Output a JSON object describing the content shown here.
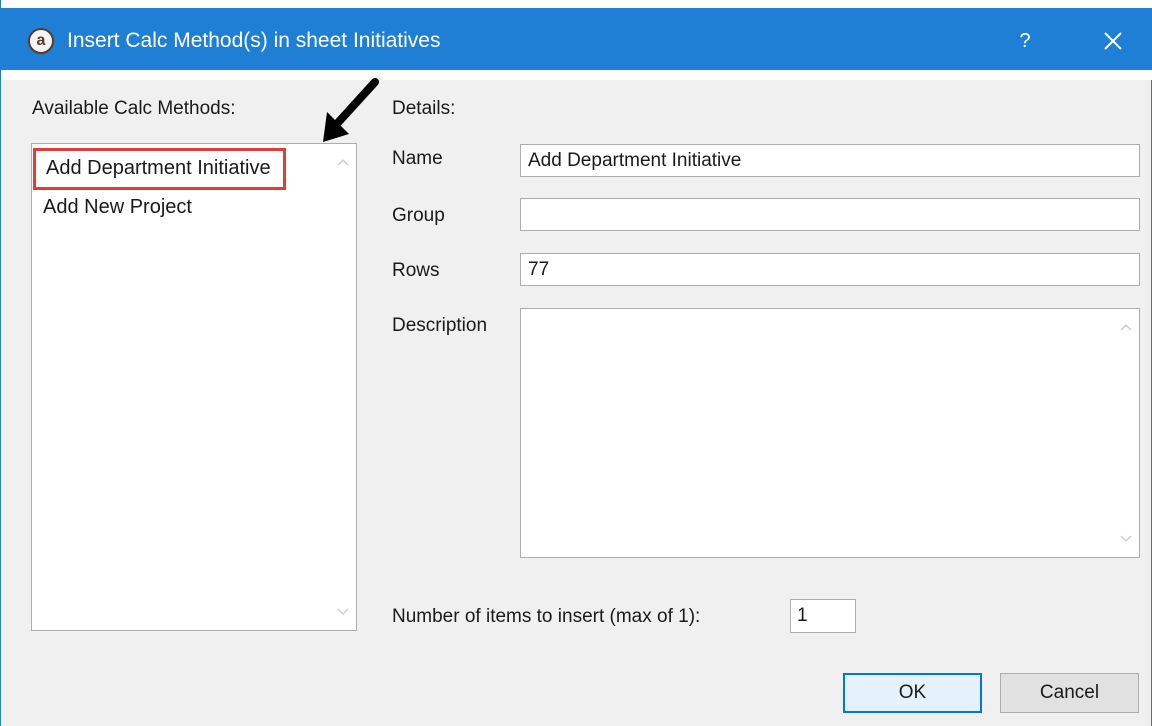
{
  "window": {
    "title": "Insert Calc Method(s) in sheet Initiatives",
    "logo_letter": "a",
    "help_label": "?",
    "close_icon": "close-icon"
  },
  "left_panel": {
    "label": "Available Calc Methods:",
    "items": [
      {
        "label": "Add Department Initiative",
        "selected": true
      },
      {
        "label": "Add New Project",
        "selected": false
      }
    ]
  },
  "details": {
    "label": "Details:",
    "name_label": "Name",
    "name_value": "Add Department Initiative",
    "group_label": "Group",
    "group_value": "",
    "rows_label": "Rows",
    "rows_value": "77",
    "description_label": "Description",
    "description_value": ""
  },
  "footer": {
    "count_label": "Number of items to insert (max of 1):",
    "count_value": "1",
    "ok_label": "OK",
    "cancel_label": "Cancel"
  },
  "colors": {
    "titlebar": "#1e7fd4",
    "highlight_border": "#e03c3c",
    "default_button_border": "#0078d7"
  }
}
